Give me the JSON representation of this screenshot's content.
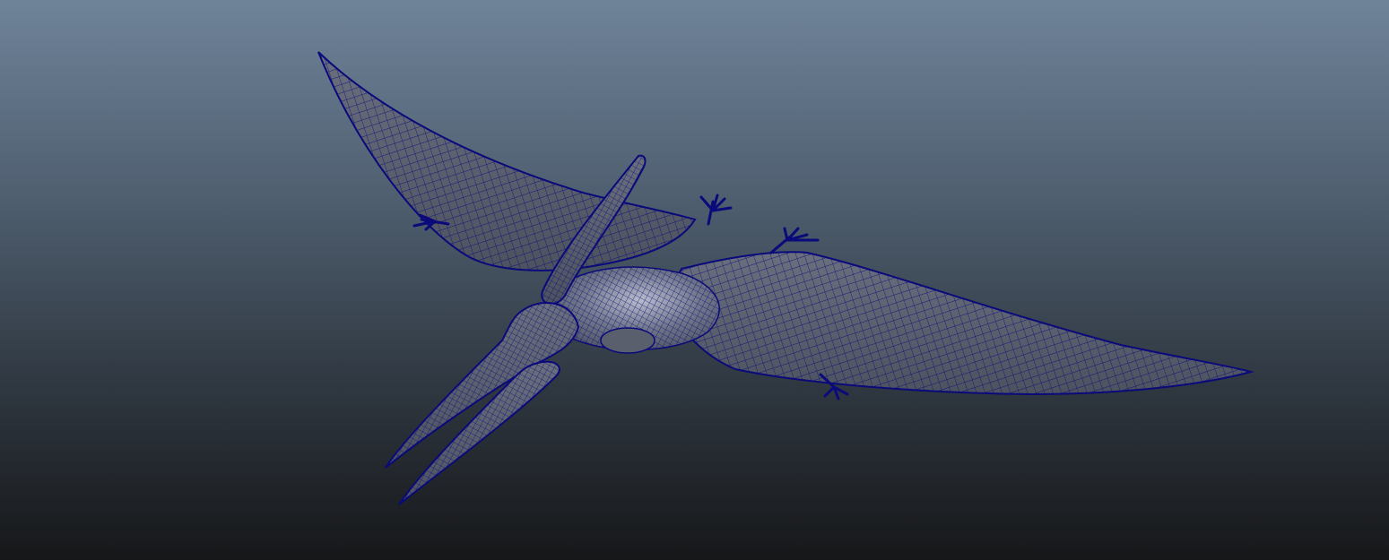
{
  "viewport": {
    "background_top": "#6f8399",
    "background_bottom": "#161719"
  },
  "model": {
    "subject": "pteranodon",
    "display_mode": "wireframe-on-shaded",
    "wire_color": "#0a0a7a",
    "surface_color": "#5d6270"
  }
}
